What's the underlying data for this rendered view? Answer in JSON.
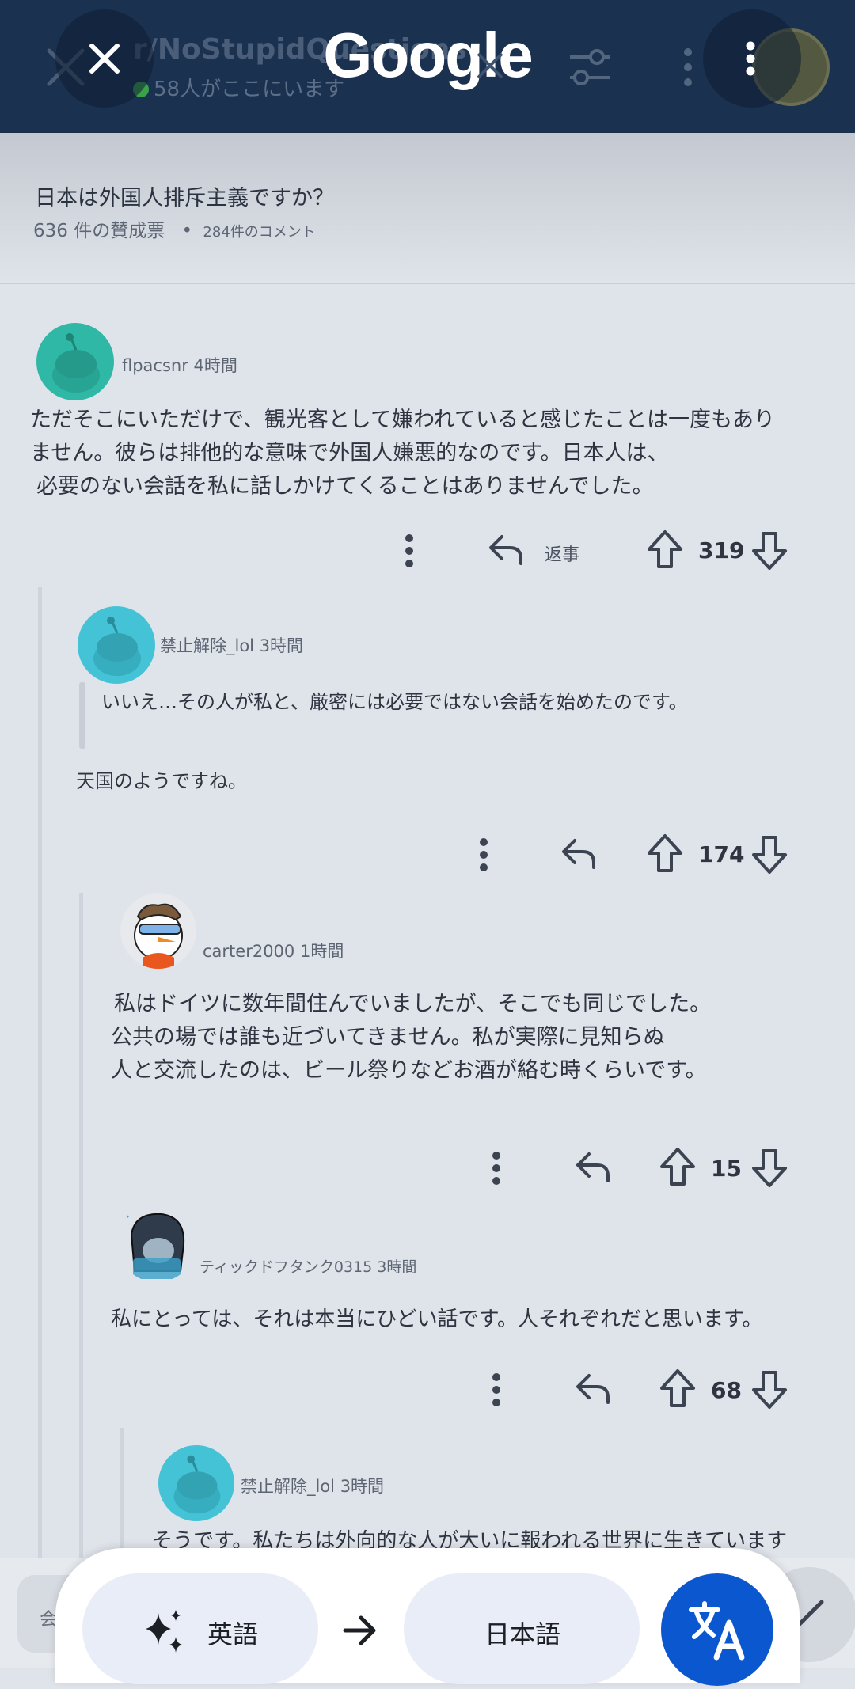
{
  "topbar": {
    "subreddit": "r/NoStupidQuestions",
    "online": "58人がここにいます",
    "logo": "Google"
  },
  "post": {
    "title": "日本は外国人排斥主義ですか？",
    "votes": "636 件の賛成票",
    "comments": "284件のコメント"
  },
  "comments": [
    {
      "user": "flpacsnr 4時間",
      "lines": [
        "ただそこにいただけで、観光客として嫌われていると感じたことは一度もあり",
        "ません。彼らは排他的な意味で外国人嫌悪的なのです。日本人は、",
        "必要のない会話を私に話しかけてくることはありませんでした。"
      ],
      "reply_label": "返事",
      "score": "319"
    },
    {
      "user": "禁止解除_lol 3時間",
      "quote": "いいえ…その人が私と、厳密には必要ではない会話を始めたのです。",
      "text": "天国のようですね。",
      "score": "174"
    },
    {
      "user": "carter2000 1時間",
      "lines": [
        "私はドイツに数年間住んでいましたが、そこでも同じでした。",
        "公共の場では誰も近づいてきません。私が実際に見知らぬ",
        "人と交流したのは、ビール祭りなどお酒が絡む時くらいです。"
      ],
      "score": "15"
    },
    {
      "user": "ティックドフタンク0315 3時間",
      "text": "私にとっては、それは本当にひどい話です。人それぞれだと思います。",
      "score": "68"
    },
    {
      "user": "禁止解除_lol 3時間",
      "text": "そうです。私たちは外向的な人が大いに報われる世界に生きています"
    }
  ],
  "translate_bar": {
    "source_lang": "英語",
    "target_lang": "日本語",
    "ghost_chip": "会"
  },
  "colors": {
    "header": "#1b3150",
    "snoo_teal": "#2fb8a5",
    "snoo_cyan": "#44c3d6",
    "translate_blue": "#0b57d0"
  },
  "icons": [
    "close-icon",
    "kebab-menu-icon",
    "filter-icon",
    "reply-arrow-icon",
    "upvote-arrow-icon",
    "downvote-arrow-icon",
    "sparkle-icon",
    "arrow-right-icon",
    "translate-icon"
  ]
}
